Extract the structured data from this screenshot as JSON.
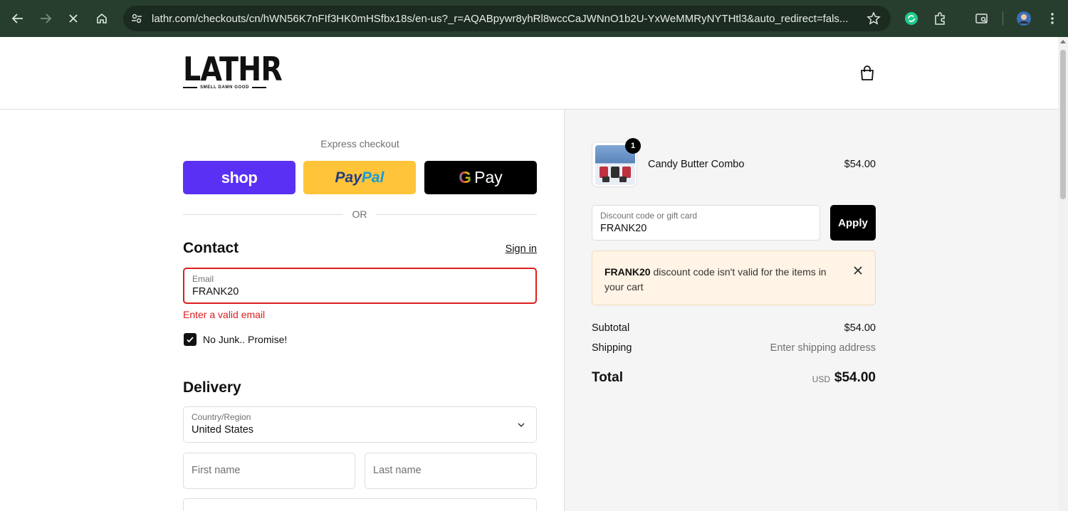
{
  "browser": {
    "url": "lathr.com/checkouts/cn/hWN56K7nFIf3HK0mHSfbx18s/en-us?_r=AQABpywr8yhRl8wccCaJWNnO1b2U-YxWeMMRyNYTHtl3&auto_redirect=fals..."
  },
  "header": {
    "logo_text": "LATHR",
    "logo_tagline": "SMELL DAMN GOOD"
  },
  "express": {
    "label": "Express checkout",
    "shop_label": "shop",
    "paypal_part1": "Pay",
    "paypal_part2": "Pal",
    "gpay_g": "G",
    "gpay_label": "Pay",
    "or_label": "OR"
  },
  "contact": {
    "title": "Contact",
    "sign_in": "Sign in",
    "email_label": "Email",
    "email_value": "FRANK20",
    "error": "Enter a valid email",
    "marketing_label": "No Junk.. Promise!"
  },
  "delivery": {
    "title": "Delivery",
    "country_label": "Country/Region",
    "country_value": "United States",
    "first_name_placeholder": "First name",
    "last_name_placeholder": "Last name"
  },
  "summary": {
    "item_name": "Candy Butter Combo",
    "item_price": "$54.00",
    "item_qty": "1",
    "discount_label": "Discount code or gift card",
    "discount_value": "FRANK20",
    "apply_label": "Apply",
    "alert_code": "FRANK20",
    "alert_text": " discount code isn't valid for the items in your cart",
    "subtotal_label": "Subtotal",
    "subtotal_value": "$54.00",
    "shipping_label": "Shipping",
    "shipping_value": "Enter shipping address",
    "total_label": "Total",
    "total_currency": "USD",
    "total_value": "$54.00"
  },
  "colors": {
    "chrome_bg": "#273e2e",
    "shop_purple": "#5a31f4",
    "paypal_yellow": "#ffc439",
    "error_red": "#dd1d1d",
    "alert_bg": "#fff4e6"
  }
}
